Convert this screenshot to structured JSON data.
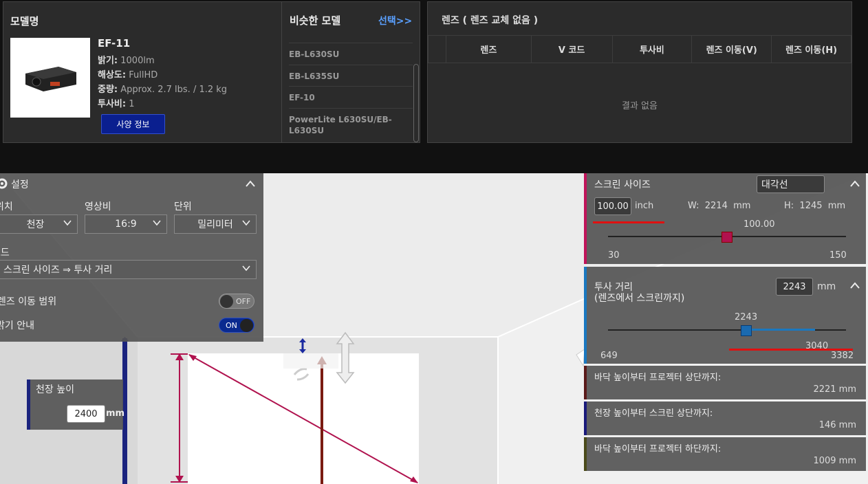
{
  "model": {
    "header": "모델명",
    "name": "EF-11",
    "specs": [
      {
        "key": "밝기:",
        "value": "1000lm"
      },
      {
        "key": "해상도:",
        "value": "FullHD"
      },
      {
        "key": "중량:",
        "value": "Approx. 2.7 lbs. / 1.2 kg"
      },
      {
        "key": "투사비:",
        "value": "1"
      }
    ],
    "spec_button": "사양 정보"
  },
  "similar": {
    "header": "비슷한 모델",
    "select_link": "선택>>",
    "items": [
      "EB-L630SU",
      "EB-L635SU",
      "EF-10",
      "PowerLite L630SU/EB-L630SU"
    ]
  },
  "lens": {
    "header": "렌즈 ( 렌즈 교체 없음 )",
    "columns": [
      "",
      "렌즈",
      "V 코드",
      "투사비",
      "렌즈 이동(V)",
      "렌즈 이동(H)"
    ],
    "empty": "결과 없음"
  },
  "settings": {
    "title": "설정",
    "position_label": "위치",
    "position_value": "천장",
    "aspect_label": "영상비",
    "aspect_value": "16:9",
    "unit_label": "단위",
    "unit_value": "밀리미터",
    "mode_label": "모드",
    "mode_value": "스크린 사이즈 ⇒ 투사 거리",
    "lens_shift_label": "렌즈 이동 범위",
    "lens_shift_toggle": "OFF",
    "brightness_label": "밝기 안내",
    "brightness_toggle": "ON"
  },
  "ceiling": {
    "label": "천장 높이",
    "value": "2400",
    "unit": "mm"
  },
  "screen_size": {
    "label": "스크린 사이즈",
    "mode": "대각선",
    "value": "100.00",
    "unit": "inch",
    "w_label": "W:",
    "w_value": "2214",
    "w_unit": "mm",
    "h_label": "H:",
    "h_value": "1245",
    "h_unit": "mm",
    "slider_value": "100.00",
    "min": "30",
    "max": "150",
    "slider_fraction": 0.5
  },
  "throw": {
    "label": "투사 거리",
    "sublabel": "(렌즈에서 스크린까지)",
    "value": "2243",
    "unit": "mm",
    "slider_value": "2243",
    "range_end": "3040",
    "min": "649",
    "max": "3382",
    "slider_fraction": 0.58,
    "range_fraction": 0.87
  },
  "info_rows": [
    {
      "label": "바닥 높이부터 프로젝터 상단까지:",
      "value": "2221 mm",
      "color": "#5a1a1a"
    },
    {
      "label": "천장 높이부터 스크린 상단까지:",
      "value": "146 mm",
      "color": "#1a1a7a"
    },
    {
      "label": "바닥 높이부터 프로젝터 하단까지:",
      "value": "1009 mm",
      "color": "#4a4a1a"
    }
  ],
  "colors": {
    "accent_link": "#5aa0ff",
    "screen_bar": "#c0145a",
    "throw_bar": "#1a78c0",
    "red_underline": "#e01010",
    "toggle_on": "#0a2a8f"
  }
}
